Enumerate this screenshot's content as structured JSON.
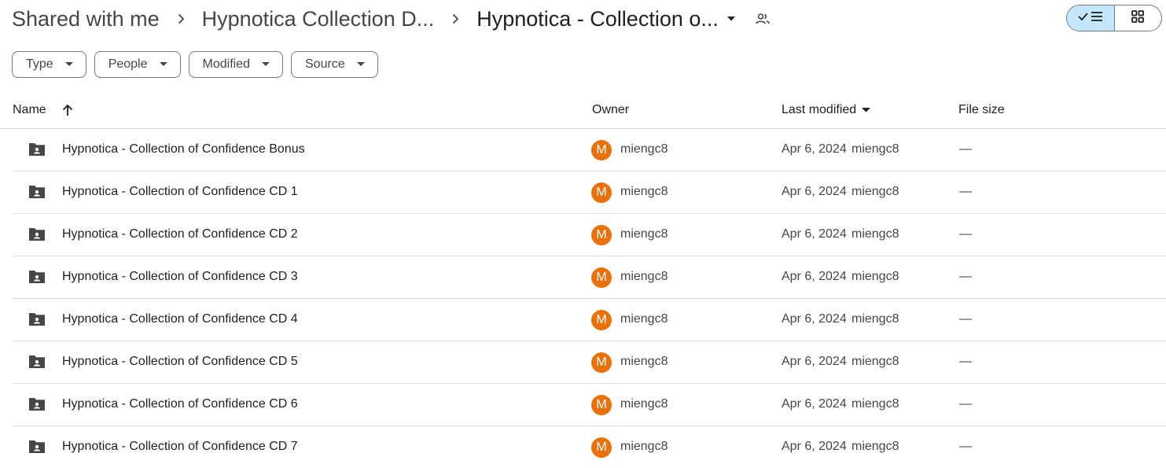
{
  "breadcrumb": {
    "root": "Shared with me",
    "parent": "Hypnotica Collection D...",
    "current": "Hypnotica - Collection o...",
    "separator_icon": "chevron-right-icon",
    "current_menu_icon": "caret-down-icon",
    "shared_icon": "people-icon"
  },
  "view_toggle": {
    "list_icon": "check-list-icon",
    "grid_icon": "grid-icon",
    "active": "list"
  },
  "filters": [
    {
      "label": "Type"
    },
    {
      "label": "People"
    },
    {
      "label": "Modified"
    },
    {
      "label": "Source"
    }
  ],
  "columns": {
    "name": "Name",
    "owner": "Owner",
    "last_modified": "Last modified",
    "file_size": "File size",
    "sort_icon": "arrow-up-icon",
    "modified_menu_icon": "caret-down-icon"
  },
  "colors": {
    "accent": "#c2e7ff",
    "avatar": "#e8710a",
    "border": "#747775"
  },
  "files": [
    {
      "name": "Hypnotica - Collection of Confidence Bonus",
      "owner_initial": "M",
      "owner": "miengc8",
      "date": "Apr 6, 2024",
      "modified_by": "miengc8",
      "size": "—",
      "icon": "shared-folder-icon"
    },
    {
      "name": "Hypnotica - Collection of Confidence CD 1",
      "owner_initial": "M",
      "owner": "miengc8",
      "date": "Apr 6, 2024",
      "modified_by": "miengc8",
      "size": "—",
      "icon": "shared-folder-icon"
    },
    {
      "name": "Hypnotica - Collection of Confidence CD 2",
      "owner_initial": "M",
      "owner": "miengc8",
      "date": "Apr 6, 2024",
      "modified_by": "miengc8",
      "size": "—",
      "icon": "shared-folder-icon"
    },
    {
      "name": "Hypnotica - Collection of Confidence CD 3",
      "owner_initial": "M",
      "owner": "miengc8",
      "date": "Apr 6, 2024",
      "modified_by": "miengc8",
      "size": "—",
      "icon": "shared-folder-icon"
    },
    {
      "name": "Hypnotica - Collection of Confidence CD 4",
      "owner_initial": "M",
      "owner": "miengc8",
      "date": "Apr 6, 2024",
      "modified_by": "miengc8",
      "size": "—",
      "icon": "shared-folder-icon"
    },
    {
      "name": "Hypnotica - Collection of Confidence CD 5",
      "owner_initial": "M",
      "owner": "miengc8",
      "date": "Apr 6, 2024",
      "modified_by": "miengc8",
      "size": "—",
      "icon": "shared-folder-icon"
    },
    {
      "name": "Hypnotica - Collection of Confidence CD 6",
      "owner_initial": "M",
      "owner": "miengc8",
      "date": "Apr 6, 2024",
      "modified_by": "miengc8",
      "size": "—",
      "icon": "shared-folder-icon"
    },
    {
      "name": "Hypnotica - Collection of Confidence CD 7",
      "owner_initial": "M",
      "owner": "miengc8",
      "date": "Apr 6, 2024",
      "modified_by": "miengc8",
      "size": "—",
      "icon": "shared-folder-icon"
    }
  ]
}
